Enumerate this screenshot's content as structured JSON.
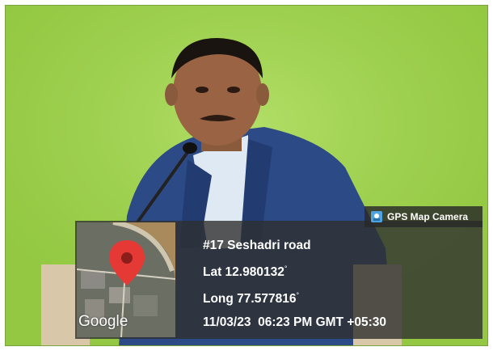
{
  "badge": {
    "label": "GPS Map Camera",
    "icon": "gps-map-camera-icon"
  },
  "location": {
    "address": "#17 Seshadri road",
    "lat": "Lat 12.980132",
    "long": "Long 77.577816",
    "degree_symbol": "°",
    "datetime": "11/03/23  06:23 PM GMT +05:30"
  },
  "map": {
    "provider": "Google",
    "pin_color": "#e53935"
  },
  "colors": {
    "background_green": "#9fd24c",
    "overlay": "#303030",
    "suit": "#2c4a86"
  }
}
